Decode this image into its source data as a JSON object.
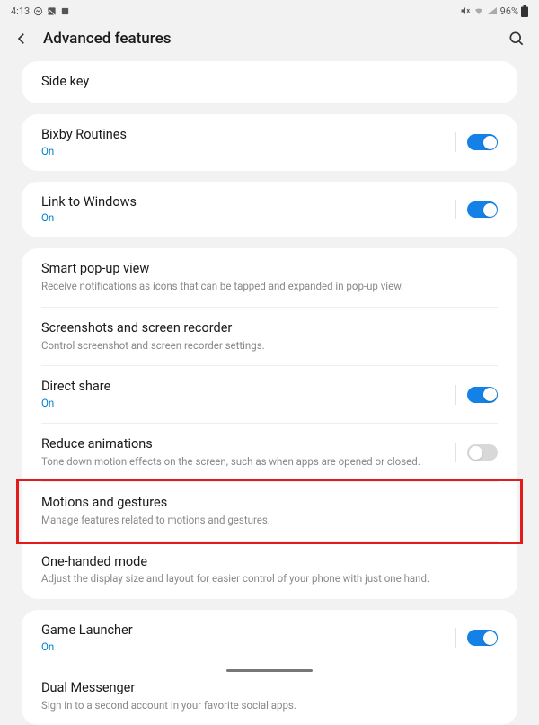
{
  "status": {
    "time": "4:13",
    "battery": "96%"
  },
  "header": {
    "title": "Advanced features"
  },
  "groups": [
    {
      "rows": [
        {
          "title": "Side key"
        }
      ]
    },
    {
      "rows": [
        {
          "title": "Bixby Routines",
          "status": "On",
          "toggle": true,
          "toggle_on": true
        }
      ]
    },
    {
      "rows": [
        {
          "title": "Link to Windows",
          "status": "On",
          "toggle": true,
          "toggle_on": true
        }
      ]
    },
    {
      "rows": [
        {
          "title": "Smart pop-up view",
          "sub": "Receive notifications as icons that can be tapped and expanded in pop-up view."
        },
        {
          "title": "Screenshots and screen recorder",
          "sub": "Control screenshot and screen recorder settings."
        },
        {
          "title": "Direct share",
          "status": "On",
          "toggle": true,
          "toggle_on": true
        },
        {
          "title": "Reduce animations",
          "sub": "Tone down motion effects on the screen, such as when apps are opened or closed.",
          "toggle": true,
          "toggle_on": false
        },
        {
          "title": "Motions and gestures",
          "sub": "Manage features related to motions and gestures.",
          "highlight": true
        },
        {
          "title": "One-handed mode",
          "sub": "Adjust the display size and layout for easier control of your phone with just one hand."
        }
      ]
    },
    {
      "rows": [
        {
          "title": "Game Launcher",
          "status": "On",
          "toggle": true,
          "toggle_on": true
        },
        {
          "title": "Dual Messenger",
          "sub": "Sign in to a second account in your favorite social apps."
        }
      ]
    }
  ]
}
